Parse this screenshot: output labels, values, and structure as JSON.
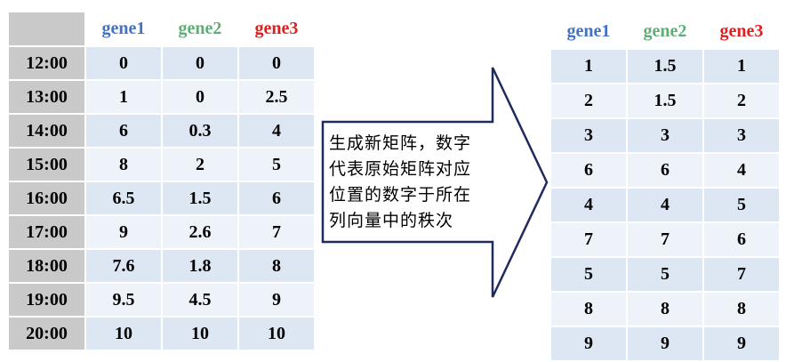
{
  "left_table": {
    "headers": [
      "",
      "gene1",
      "gene2",
      "gene3"
    ],
    "rows": [
      [
        "12:00",
        "0",
        "0",
        "0"
      ],
      [
        "13:00",
        "1",
        "0",
        "2.5"
      ],
      [
        "14:00",
        "6",
        "0.3",
        "4"
      ],
      [
        "15:00",
        "8",
        "2",
        "5"
      ],
      [
        "16:00",
        "6.5",
        "1.5",
        "6"
      ],
      [
        "17:00",
        "9",
        "2.6",
        "7"
      ],
      [
        "18:00",
        "7.6",
        "1.8",
        "8"
      ],
      [
        "19:00",
        "9.5",
        "4.5",
        "9"
      ],
      [
        "20:00",
        "10",
        "10",
        "10"
      ]
    ]
  },
  "arrow_text": {
    "lines": [
      "生成新矩阵，数字",
      "代表原始矩阵对应",
      "位置的数字于所在",
      "列向量中的秩次"
    ]
  },
  "right_table": {
    "headers": [
      "gene1",
      "gene2",
      "gene3"
    ],
    "rows": [
      [
        "1",
        "1.5",
        "1"
      ],
      [
        "2",
        "1.5",
        "2"
      ],
      [
        "3",
        "3",
        "3"
      ],
      [
        "6",
        "6",
        "4"
      ],
      [
        "4",
        "4",
        "5"
      ],
      [
        "7",
        "7",
        "6"
      ],
      [
        "5",
        "5",
        "7"
      ],
      [
        "8",
        "8",
        "8"
      ],
      [
        "9",
        "9",
        "9"
      ]
    ]
  },
  "colors": {
    "gene1": "#4472c4",
    "gene2": "#5fae78",
    "gene3": "#e02020",
    "row_band_dark": "#dde7f4",
    "row_band_light": "#eef3fa",
    "header_gray": "#c9c9c9",
    "arrow_stroke": "#1f2a5e"
  }
}
